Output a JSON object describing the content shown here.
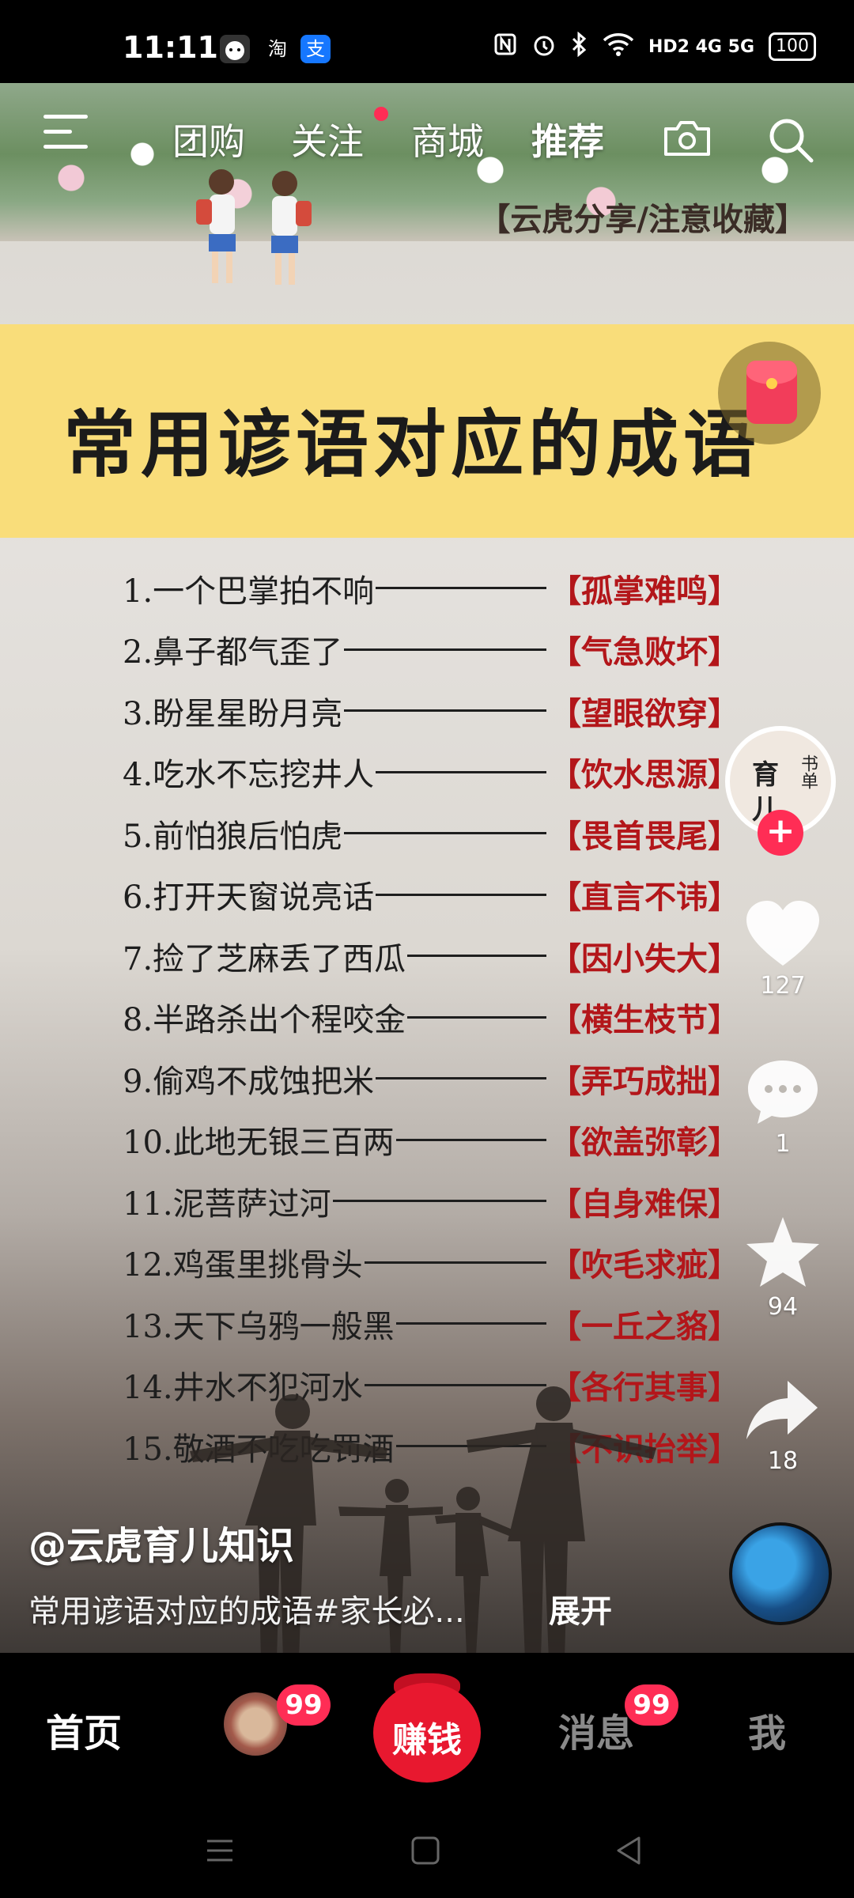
{
  "status_bar": {
    "time": "11:11",
    "app_icons": [
      "淘",
      "支"
    ],
    "network": "HD2 4G 5G",
    "battery": "100"
  },
  "top_nav": {
    "tabs": [
      {
        "label": "团购"
      },
      {
        "label": "关注"
      },
      {
        "label": "商城"
      },
      {
        "label": "推荐"
      }
    ]
  },
  "banner": {
    "tag": "【云虎分享/注意收藏】",
    "title": "常用谚语对应的成语"
  },
  "idioms": [
    {
      "saying": "1.一个巴掌拍不响",
      "idiom": "【孤掌难鸣】"
    },
    {
      "saying": "2.鼻子都气歪了",
      "idiom": "【气急败坏】"
    },
    {
      "saying": "3.盼星星盼月亮",
      "idiom": "【望眼欲穿】"
    },
    {
      "saying": "4.吃水不忘挖井人",
      "idiom": "【饮水思源】"
    },
    {
      "saying": "5.前怕狼后怕虎",
      "idiom": "【畏首畏尾】"
    },
    {
      "saying": "6.打开天窗说亮话",
      "idiom": "【直言不讳】"
    },
    {
      "saying": "7.捡了芝麻丢了西瓜",
      "idiom": "【因小失大】"
    },
    {
      "saying": "8.半路杀出个程咬金",
      "idiom": "【横生枝节】"
    },
    {
      "saying": "9.偷鸡不成蚀把米",
      "idiom": "【弄巧成拙】"
    },
    {
      "saying": "10.此地无银三百两",
      "idiom": "【欲盖弥彰】"
    },
    {
      "saying": "11.泥菩萨过河",
      "idiom": "【自身难保】"
    },
    {
      "saying": "12.鸡蛋里挑骨头",
      "idiom": "【吹毛求疵】"
    },
    {
      "saying": "13.天下乌鸦一般黑",
      "idiom": "【一丘之貉】"
    },
    {
      "saying": "14.井水不犯河水",
      "idiom": "【各行其事】"
    },
    {
      "saying": "15.敬酒不吃吃罚酒",
      "idiom": "【不识抬举】"
    }
  ],
  "author_avatar": {
    "line1": "育",
    "line2": "儿",
    "side": "书单"
  },
  "actions": {
    "likes": "127",
    "comments": "1",
    "favorites": "94",
    "shares": "18"
  },
  "caption": {
    "author": "@云虎育儿知识",
    "description": "常用谚语对应的成语#家长必...",
    "expand": "展开"
  },
  "bottom_nav": {
    "home": "首页",
    "friends_badge": "99",
    "earn": "赚钱",
    "messages": "消息",
    "messages_badge": "99",
    "me": "我"
  },
  "colors": {
    "accent": "#ff2d55",
    "title_band": "#f9dd7a",
    "idiom_red": "#b3161a"
  }
}
